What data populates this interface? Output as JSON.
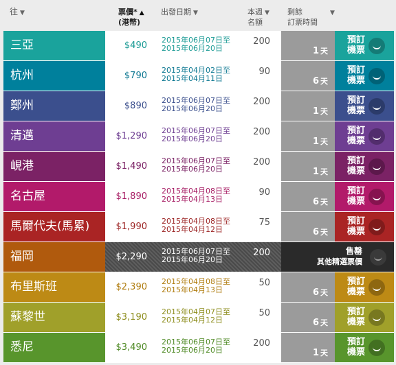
{
  "header": {
    "dest": "往",
    "price_l1": "票價*",
    "price_l2": "(港幣)",
    "date": "出發日期",
    "quota_l1": "本週",
    "quota_l2": "名額",
    "remain_l1": "剩餘",
    "remain_l2": "訂票時間"
  },
  "book_label_l1": "預訂",
  "book_label_l2": "機票",
  "sold_label_l1": "售罄",
  "sold_label_l2": "其他精選票價",
  "day_unit": "天",
  "rows": [
    {
      "name": "三亞",
      "price": "$490",
      "date1": "2015年06月07日至",
      "date2": "2015年06月20日",
      "quota": "200",
      "days": "1",
      "color": "#1aa39c",
      "dark": "#147b76",
      "text": "#1a9a94"
    },
    {
      "name": "杭州",
      "price": "$790",
      "date1": "2015年04月02日至",
      "date2": "2015年04月11日",
      "quota": "90",
      "days": "6",
      "color": "#00809c",
      "dark": "#006277",
      "text": "#0b7791"
    },
    {
      "name": "鄭州",
      "price": "$890",
      "date1": "2015年06月07日至",
      "date2": "2015年06月20日",
      "quota": "200",
      "days": "1",
      "color": "#3b4f8d",
      "dark": "#2b3b6a",
      "text": "#3b4f8d"
    },
    {
      "name": "清邁",
      "price": "$1,290",
      "date1": "2015年06月07日至",
      "date2": "2015年06月20日",
      "quota": "200",
      "days": "1",
      "color": "#6e3e92",
      "dark": "#522d6d",
      "text": "#6e3e92"
    },
    {
      "name": "峴港",
      "price": "$1,490",
      "date1": "2015年06月07日至",
      "date2": "2015年06月20日",
      "quota": "200",
      "days": "1",
      "color": "#7b2265",
      "dark": "#5c184b",
      "text": "#7b2265"
    },
    {
      "name": "名古屋",
      "price": "$1,890",
      "date1": "2015年04月08日至",
      "date2": "2015年04月13日",
      "quota": "90",
      "days": "6",
      "color": "#b21a6a",
      "dark": "#86134f",
      "text": "#a71d64"
    },
    {
      "name": "馬爾代夫(馬累)",
      "price": "$1,990",
      "date1": "2015年04月08日至",
      "date2": "2015年04月12日",
      "quota": "75",
      "days": "6",
      "color": "#aa2424",
      "dark": "#801b1b",
      "text": "#9c2424"
    },
    {
      "name": "福岡",
      "price": "$2,290",
      "date1": "2015年06月07日至",
      "date2": "2015年06月20日",
      "quota": "200",
      "days": "",
      "color": "#b05a0d",
      "dark": "#844409",
      "text": "#ffffff",
      "sold": true
    },
    {
      "name": "布里斯班",
      "price": "$2,390",
      "date1": "2015年04月08日至",
      "date2": "2015年04月13日",
      "quota": "50",
      "days": "6",
      "color": "#bd8a15",
      "dark": "#8e6710",
      "text": "#b07d10"
    },
    {
      "name": "蘇黎世",
      "price": "$3,190",
      "date1": "2015年04月07日至",
      "date2": "2015年04月12日",
      "quota": "50",
      "days": "6",
      "color": "#a0a02a",
      "dark": "#787820",
      "text": "#8e8e1e"
    },
    {
      "name": "悉尼",
      "price": "$3,490",
      "date1": "2015年06月07日至",
      "date2": "2015年06月20日",
      "quota": "200",
      "days": "1",
      "color": "#58952c",
      "dark": "#427021",
      "text": "#4f8a25"
    }
  ]
}
